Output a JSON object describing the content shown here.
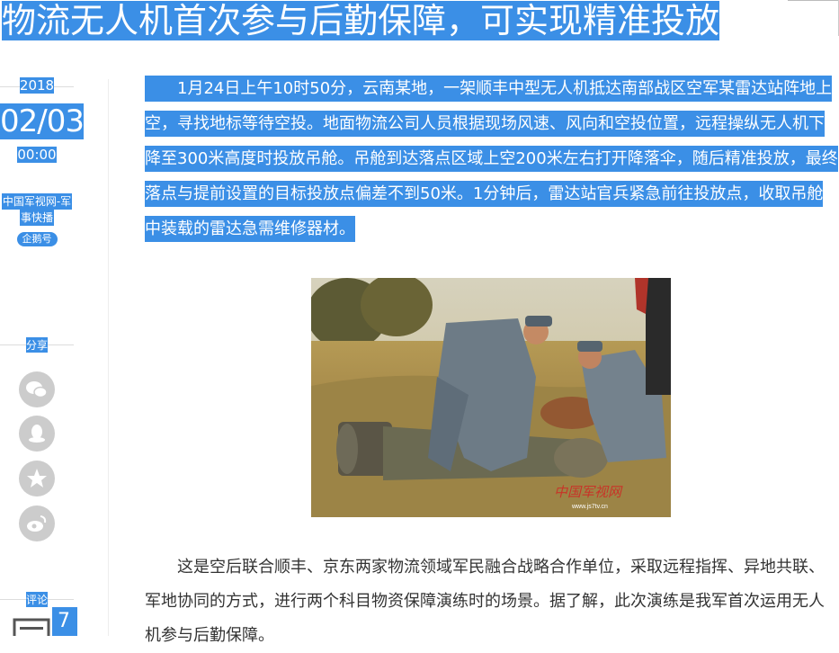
{
  "article": {
    "title": "物流无人机首次参与后勤保障，可实现精准投放",
    "paragraph1": "1月24日上午10时50分，云南某地，一架顺丰中型无人机抵达南部战区空军某雷达站阵地上空，寻找地标等待空投。地面物流公司人员根据现场风速、风向和空投位置，远程操纵无人机下降至300米高度时投放吊舱。吊舱到达落点区域上空200米左右打开降落伞，随后精准投放，最终落点与提前设置的目标投放点偏差不到50米。1分钟后，雷达站官兵紧急前往投放点，收取吊舱中装载的雷达急需维修器材。",
    "paragraph2": "这是空后联合顺丰、京东两家物流领域军民融合战略合作单位，采取远程指挥、异地共联、军地协同的方式，进行两个科目物资保障演练时的场景。据了解，此次演练是我军首次运用无人机参与后勤保障。",
    "photo_watermark": "中国军视网",
    "photo_url_text": "www.js7tv.cn"
  },
  "sidebar": {
    "year": "2018",
    "date": "02/03",
    "time": "00:00",
    "source_line1": "中国军视网-军",
    "source_line2": "事快播",
    "badge": "企鹅号",
    "share_label": "分享",
    "comment_label": "评论",
    "comment_count": "7"
  },
  "share_icons": [
    "wechat-icon",
    "qq-icon",
    "qzone-icon",
    "weibo-icon"
  ],
  "colors": {
    "selection": "#3b8fe6",
    "icon_bg": "#cccccc"
  }
}
